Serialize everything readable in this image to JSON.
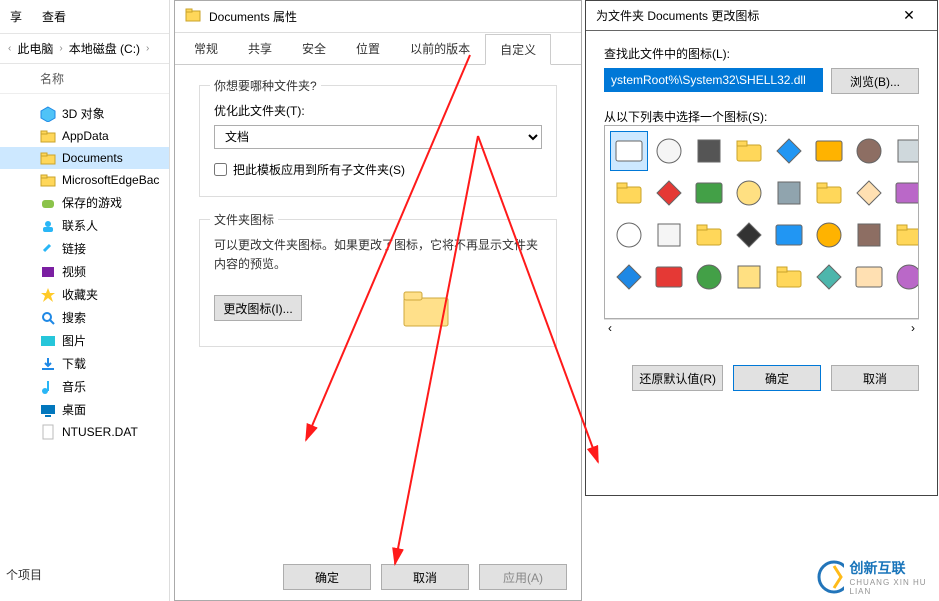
{
  "explorer": {
    "menu": {
      "share": "享",
      "view": "查看"
    },
    "crumb": {
      "pc": "此电脑",
      "drive": "本地磁盘 (C:)"
    },
    "header_name": "名称",
    "items": [
      {
        "label": "3D 对象",
        "icon": "cube",
        "selected": false
      },
      {
        "label": "AppData",
        "icon": "folder",
        "selected": false
      },
      {
        "label": "Documents",
        "icon": "folder",
        "selected": true
      },
      {
        "label": "MicrosoftEdgeBac",
        "icon": "folder",
        "selected": false
      },
      {
        "label": "保存的游戏",
        "icon": "games",
        "selected": false
      },
      {
        "label": "联系人",
        "icon": "contacts",
        "selected": false
      },
      {
        "label": "链接",
        "icon": "links",
        "selected": false
      },
      {
        "label": "视频",
        "icon": "video",
        "selected": false
      },
      {
        "label": "收藏夹",
        "icon": "star",
        "selected": false
      },
      {
        "label": "搜索",
        "icon": "search",
        "selected": false
      },
      {
        "label": "图片",
        "icon": "pictures",
        "selected": false
      },
      {
        "label": "下载",
        "icon": "downloads",
        "selected": false
      },
      {
        "label": "音乐",
        "icon": "music",
        "selected": false
      },
      {
        "label": "桌面",
        "icon": "desktop",
        "selected": false
      },
      {
        "label": "NTUSER.DAT",
        "icon": "file",
        "selected": false
      }
    ],
    "footer_label": "个项目"
  },
  "props": {
    "title": "Documents 属性",
    "tabs": [
      "常规",
      "共享",
      "安全",
      "位置",
      "以前的版本",
      "自定义"
    ],
    "active_tab": 5,
    "grp_kind": {
      "title": "你想要哪种文件夹?",
      "optimize_label": "优化此文件夹(T):",
      "optimize_value": "文档",
      "apply_sub": "把此模板应用到所有子文件夹(S)"
    },
    "grp_icon": {
      "title": "文件夹图标",
      "desc": "可以更改文件夹图标。如果更改了图标，它将不再显示文件夹内容的预览。",
      "change_btn": "更改图标(I)..."
    },
    "footer": {
      "ok": "确定",
      "cancel": "取消",
      "apply": "应用(A)"
    }
  },
  "icon_dlg": {
    "title": "为文件夹 Documents 更改图标",
    "find_label": "查找此文件中的图标(L):",
    "path_value": "ystemRoot%\\System32\\SHELL32.dll",
    "browse": "浏览(B)...",
    "select_label": "从以下列表中选择一个图标(S):",
    "footer": {
      "restore": "还原默认值(R)",
      "ok": "确定",
      "cancel": "取消"
    }
  },
  "watermark": {
    "brand": "创新互联"
  }
}
